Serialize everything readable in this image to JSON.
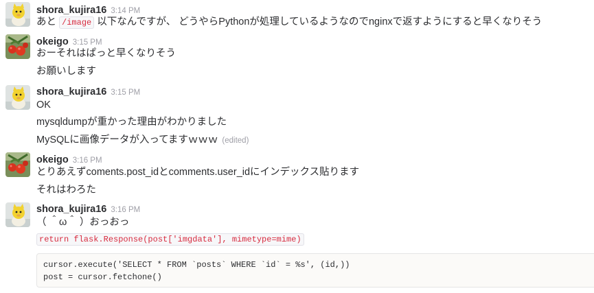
{
  "messages": [
    {
      "user": "shora_kujira16",
      "time": "3:14 PM",
      "lines": [
        {
          "pre": "あと ",
          "code": "/image",
          "post": " 以下なんですが、 どうやらPythonが処理しているようなのでnginxで返すようにすると早くなりそう"
        }
      ]
    },
    {
      "user": "okeigo",
      "time": "3:15 PM",
      "lines": [
        {
          "text": "おーそれはぱっと早くなりそう"
        },
        {
          "text": "お願いします"
        }
      ]
    },
    {
      "user": "shora_kujira16",
      "time": "3:15 PM",
      "lines": [
        {
          "text": "OK"
        },
        {
          "text": "mysqldumpが重かった理由がわかりました"
        },
        {
          "text": "MySQLに画像データが入ってますｗｗｗ",
          "edited": "(edited)"
        }
      ]
    },
    {
      "user": "okeigo",
      "time": "3:16 PM",
      "lines": [
        {
          "text": "とりあえずcoments.post_idとcomments.user_idにインデックス貼ります"
        },
        {
          "text": "それはわろた"
        }
      ]
    },
    {
      "user": "shora_kujira16",
      "time": "3:16 PM",
      "lines": [
        {
          "text": "（ ＾ω＾ ）おっおっ"
        },
        {
          "code": "return flask.Response(post['imgdata'], mimetype=mime)"
        }
      ],
      "code_block": "cursor.execute('SELECT * FROM `posts` WHERE `id` = %s', (id,))\npost = cursor.fetchone()"
    }
  ],
  "colors": {
    "text": "#2c2d30",
    "timestamp": "#9e9ea6",
    "inline_code": "#d72b3f",
    "code_bg": "#fbfaf8"
  },
  "icons": {
    "shora_avatar": "yellow-cat-avatar",
    "okeigo_avatar": "tomato-plant-avatar"
  }
}
